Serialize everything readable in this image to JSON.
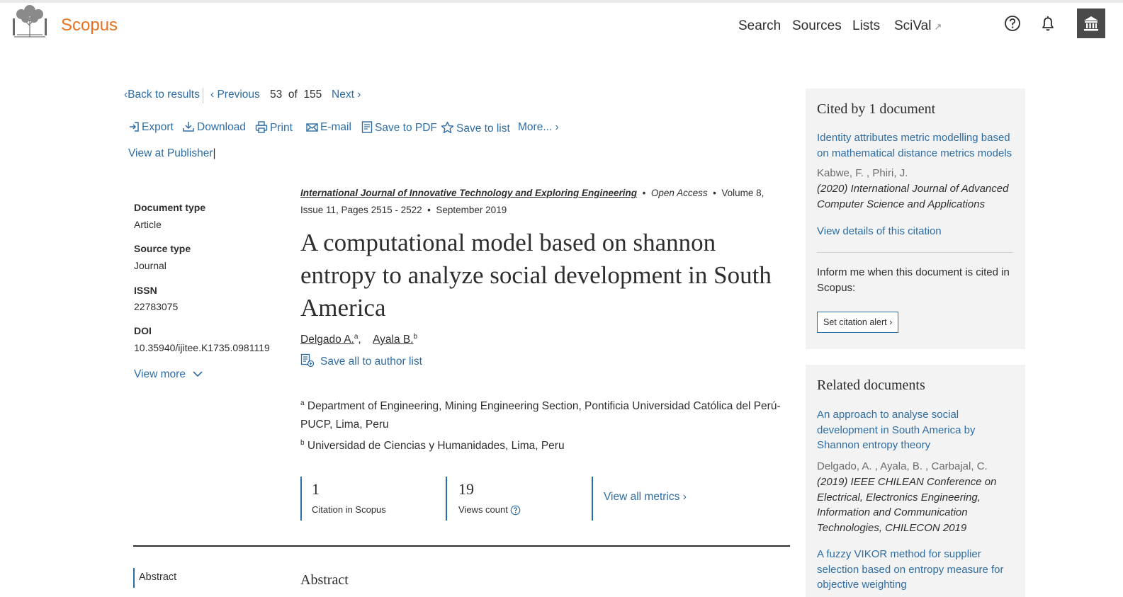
{
  "header": {
    "brand": "Scopus",
    "nav": [
      "Search",
      "Sources",
      "Lists",
      "SciVal"
    ],
    "scival_ext": "↗"
  },
  "navigation": {
    "back": "Back to results",
    "previous": "Previous",
    "current": "53",
    "of": "of",
    "total": "155",
    "next": "Next"
  },
  "toolbar": {
    "export": "Export",
    "download": "Download",
    "print": "Print",
    "email": "E-mail",
    "save_pdf": "Save to PDF",
    "save_list": "Save to list",
    "more": "More...",
    "publisher": "View at Publisher"
  },
  "meta": {
    "doctype_label": "Document type",
    "doctype": "Article",
    "sourcetype_label": "Source type",
    "sourcetype": "Journal",
    "issn_label": "ISSN",
    "issn": "22783075",
    "doi_label": "DOI",
    "doi": "10.35940/ijitee.K1735.0981119",
    "view_more": "View more"
  },
  "document": {
    "journal": "International Journal of Innovative Technology and Exploring Engineering",
    "open_access": "Open Access",
    "volume_line": "Volume 8, Issue 11, Pages 2515 - 2522",
    "date": "September 2019",
    "title": "A computational model based on shannon entropy to analyze social development in South America",
    "authors": [
      {
        "name": "Delgado A.",
        "sup": "a"
      },
      {
        "name": "Ayala B.",
        "sup": "b"
      }
    ],
    "save_authors": "Save all to author list",
    "affiliations": [
      {
        "sup": "a",
        "text": "Department of Engineering, Mining Engineering Section, Pontificia Universidad Católica del Perú-PUCP, Lima, Peru"
      },
      {
        "sup": "b",
        "text": "Universidad de Ciencias y Humanidades, Lima, Peru"
      }
    ]
  },
  "metrics": {
    "citations": "1",
    "citations_label": "Citation in Scopus",
    "views": "19",
    "views_label": "Views count",
    "view_all": "View all metrics"
  },
  "abstract": {
    "side_label": "Abstract",
    "heading": "Abstract"
  },
  "cited_panel": {
    "heading": "Cited by 1 document",
    "item_title": "Identity attributes metric modelling based on mathematical distance metrics models",
    "item_authors": "Kabwe, F. , Phiri, J.",
    "item_source": "(2020) International Journal of Advanced Computer Science and Applications",
    "details_link": "View details of this citation",
    "inform_text": "Inform me when this document is cited in Scopus:",
    "alert_button": "Set citation alert"
  },
  "related_panel": {
    "heading": "Related documents",
    "items": [
      {
        "title": "An approach to analyse social development in South America by Shannon entropy theory",
        "authors": "Delgado, A. , Ayala, B. , Carbajal, C.",
        "source": "(2019) IEEE CHILEAN Conference on Electrical, Electronics Engineering, Information and Communication Technologies, CHILECON 2019"
      },
      {
        "title": "A fuzzy VIKOR method for supplier selection based on entropy measure for objective weighting"
      }
    ]
  },
  "colors": {
    "brand": "#e9711c",
    "link": "#2e6da4",
    "text": "#2e2e2e",
    "panel_bg": "#f3f3f3"
  }
}
